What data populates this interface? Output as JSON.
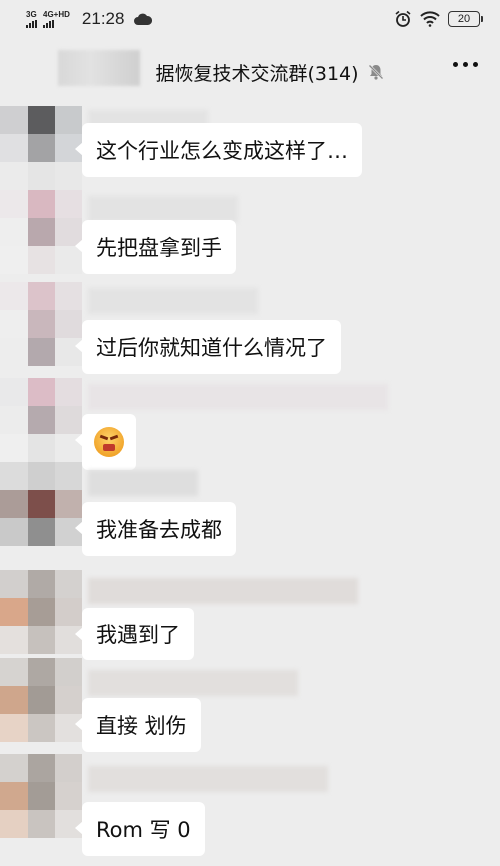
{
  "status_bar": {
    "network_1": "3G",
    "network_2": "4G+HD",
    "time": "21:28",
    "battery": "20",
    "icons": [
      "signal-icon",
      "cloud-icon",
      "alarm-icon",
      "wifi-icon",
      "battery-icon"
    ]
  },
  "nav": {
    "title": "据恢复技术交流群(314)",
    "muted_icon": "mute-bell-icon",
    "more_icon": "more-dots-icon"
  },
  "messages": [
    {
      "type": "text",
      "text": "这个行业怎么变成这样了…"
    },
    {
      "type": "text",
      "text": "先把盘拿到手"
    },
    {
      "type": "text",
      "text": "过后你就知道什么情况了"
    },
    {
      "type": "emoji",
      "text": "",
      "emoji": "angry-face-emoji"
    },
    {
      "type": "text",
      "text": "我准备去成都"
    },
    {
      "type": "text",
      "text": "我遇到了"
    },
    {
      "type": "text",
      "text": "直接 划伤"
    },
    {
      "type": "text",
      "text": "Rom 写 0"
    }
  ],
  "colors": {
    "background": "#ededed",
    "bubble": "#ffffff",
    "text": "#111111"
  }
}
